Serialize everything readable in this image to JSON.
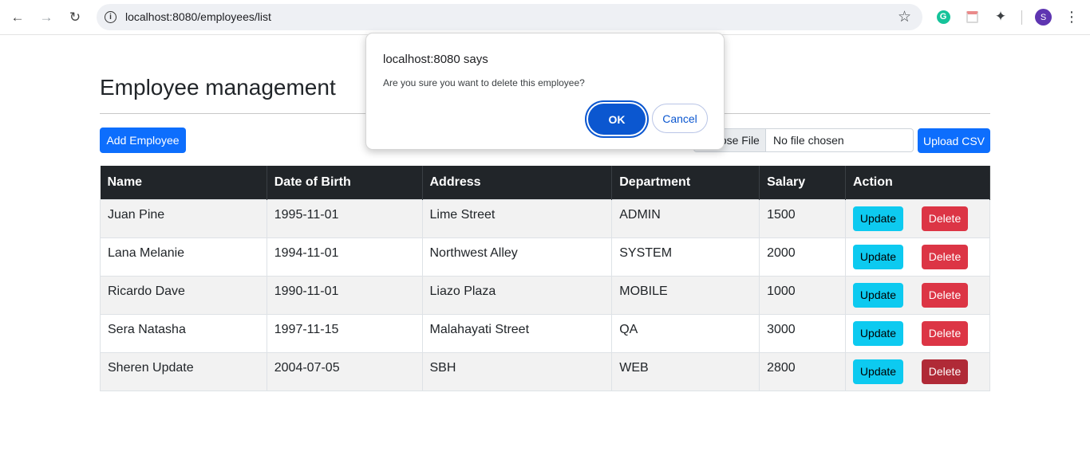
{
  "browser": {
    "url": "localhost:8080/employees/list",
    "avatar_letter": "S",
    "extension_g": "G"
  },
  "page": {
    "title": "Employee management",
    "add_button": "Add Employee",
    "file_choose": "Choose File",
    "file_name": "No file chosen",
    "upload_button": "Upload CSV"
  },
  "table": {
    "headers": [
      "Name",
      "Date of Birth",
      "Address",
      "Department",
      "Salary",
      "Action"
    ],
    "update_label": "Update",
    "delete_label": "Delete",
    "rows": [
      {
        "name": "Juan Pine",
        "dob": "1995-11-01",
        "address": "Lime Street",
        "department": "ADMIN",
        "salary": "1500"
      },
      {
        "name": "Lana Melanie",
        "dob": "1994-11-01",
        "address": "Northwest Alley",
        "department": "SYSTEM",
        "salary": "2000"
      },
      {
        "name": "Ricardo Dave",
        "dob": "1990-11-01",
        "address": "Liazo Plaza",
        "department": "MOBILE",
        "salary": "1000"
      },
      {
        "name": "Sera Natasha",
        "dob": "1997-11-15",
        "address": "Malahayati Street",
        "department": "QA",
        "salary": "3000"
      },
      {
        "name": "Sheren Update",
        "dob": "2004-07-05",
        "address": "SBH",
        "department": "WEB",
        "salary": "2800"
      }
    ]
  },
  "dialog": {
    "title": "localhost:8080 says",
    "message": "Are you sure you want to delete this employee?",
    "ok": "OK",
    "cancel": "Cancel"
  },
  "colors": {
    "primary": "#0d6efd",
    "info": "#0dcaf0",
    "danger": "#dc3545",
    "header_bg": "#212529",
    "dialog_accent": "#0b57d0"
  },
  "icons": [
    "back-arrow-icon",
    "forward-arrow-icon",
    "reload-icon",
    "info-icon",
    "star-icon",
    "grammarly-icon",
    "calendar-icon",
    "puzzle-icon",
    "menu-dots-icon"
  ]
}
